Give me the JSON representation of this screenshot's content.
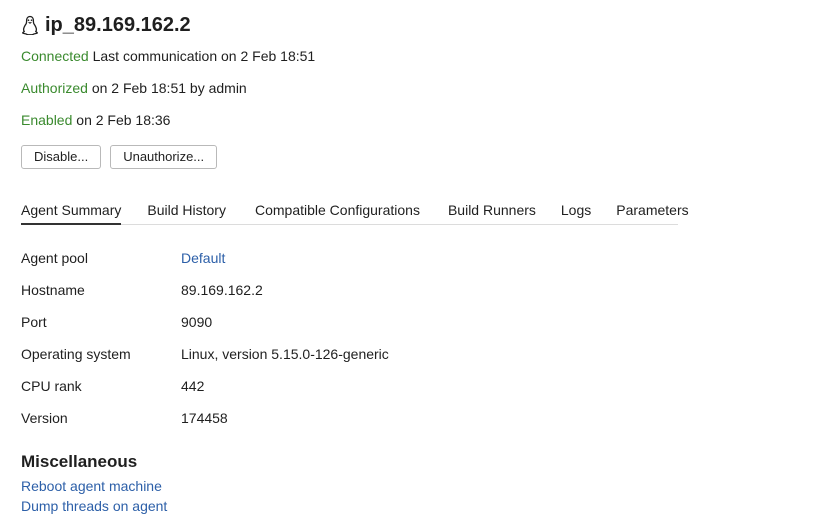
{
  "header": {
    "icon": "linux-penguin-icon",
    "title": "ip_89.169.162.2"
  },
  "status": {
    "connected_word": "Connected",
    "connected_detail": " Last communication on 2 Feb 18:51",
    "authorized_word": "Authorized",
    "authorized_detail": " on 2 Feb 18:51 by admin",
    "enabled_word": "Enabled",
    "enabled_detail": " on 2 Feb 18:36",
    "status_color": "#3a8a2e"
  },
  "actions": {
    "disable_label": "Disable...",
    "unauthorize_label": "Unauthorize..."
  },
  "tabs": [
    {
      "label": "Agent Summary",
      "active": true
    },
    {
      "label": "Build History",
      "active": false
    },
    {
      "label": "Compatible Configurations",
      "active": false
    },
    {
      "label": "Build Runners",
      "active": false
    },
    {
      "label": "Logs",
      "active": false
    },
    {
      "label": "Parameters",
      "active": false
    }
  ],
  "summary": {
    "agent_pool_label": "Agent pool",
    "agent_pool_value": "Default",
    "hostname_label": "Hostname",
    "hostname_value": "89.169.162.2",
    "port_label": "Port",
    "port_value": "9090",
    "os_label": "Operating system",
    "os_value": "Linux, version 5.15.0-126-generic",
    "cpu_label": "CPU rank",
    "cpu_value": "442",
    "version_label": "Version",
    "version_value": "174458"
  },
  "misc": {
    "heading": "Miscellaneous",
    "reboot_link": "Reboot agent machine",
    "dump_link": "Dump threads on agent"
  },
  "colors": {
    "link": "#2c5fa8",
    "text": "#1f1f1f"
  }
}
